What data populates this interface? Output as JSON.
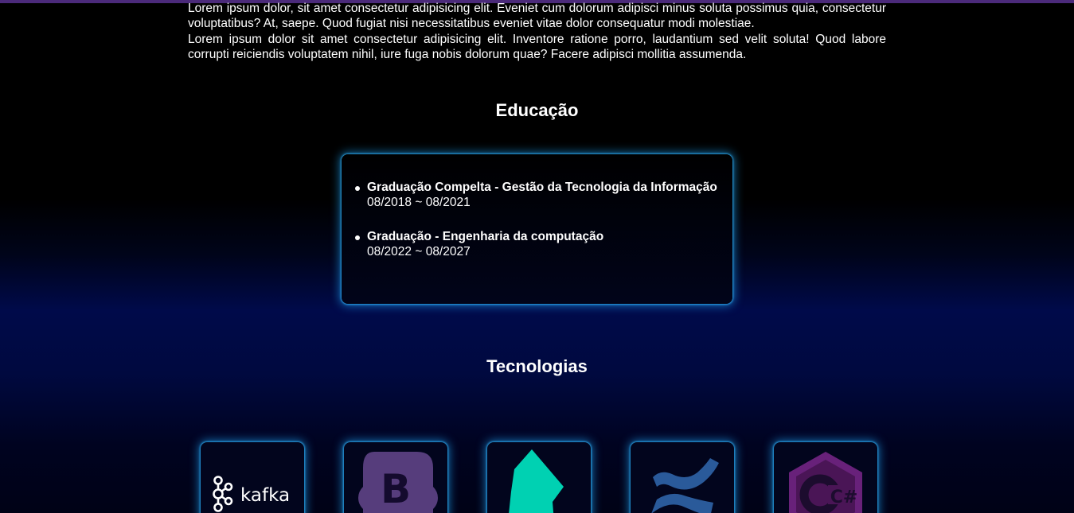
{
  "intro": {
    "paragraph_1": "Lorem ipsum dolor, sit amet consectetur adipisicing elit. Eveniet cum dolorum adipisci minus soluta possimus quia, consectetur voluptatibus? At, saepe. Quod fugiat nisi necessitatibus eveniet vitae dolor consequatur modi molestiae.",
    "paragraph_2": "Lorem ipsum dolor sit amet consectetur adipisicing elit. Inventore ratione porro, laudantium sed velit soluta! Quod labore corrupti reiciendis voluptatem nihil, iure fuga nobis dolorum quae? Facere adipisci mollitia assumenda."
  },
  "education": {
    "title": "Educação",
    "items": [
      {
        "name": "Graduação Compelta - Gestão da Tecnologia da Informação",
        "period": "08/2018 ~ 08/2021"
      },
      {
        "name": "Graduação - Engenharia da computação",
        "period": "08/2022 ~ 08/2027"
      }
    ]
  },
  "technologies": {
    "title": "Tecnologias",
    "items": [
      {
        "icon": "kafka-icon",
        "label": "kafka"
      },
      {
        "icon": "bootstrap-icon",
        "label": "B"
      },
      {
        "icon": "bitbucket-like-icon"
      },
      {
        "icon": "confluence-icon"
      },
      {
        "icon": "csharp-icon",
        "label": "C#"
      }
    ]
  },
  "colors": {
    "accent_glow": "#1eaaff",
    "top_bar": "#4b2a7a",
    "bootstrap_purple": "#563d7c",
    "teal": "#00d1b2",
    "confluence_blue": "#2a5a9a",
    "csharp_purple": "#68217a"
  }
}
